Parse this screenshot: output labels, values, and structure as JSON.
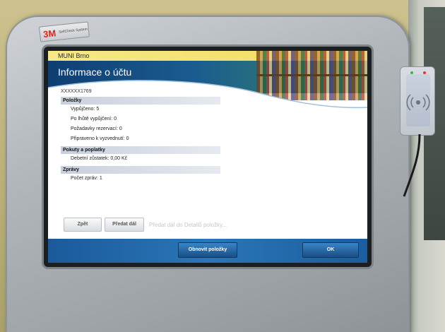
{
  "kiosk": {
    "brand_logo": "3M",
    "brand_sub": "SelfCheck System"
  },
  "screen": {
    "library_name": "MUNI Brno",
    "title": "Informace o účtu",
    "card_id": "XXXXXX1769",
    "sections": {
      "items": {
        "heading": "Položky",
        "rows": [
          "Vypůjčeno: 5",
          "Po lhůtě vypůjčení: 0",
          "Požadavky rezervací: 0",
          "Připraveno k vyzvednutí: 0"
        ]
      },
      "fines": {
        "heading": "Pokuty a poplatky",
        "rows": [
          "Debetní zůstatek: 0,00 Kč"
        ]
      },
      "messages": {
        "heading": "Zprávy",
        "rows": [
          "Počet zpráv: 1"
        ]
      }
    },
    "buttons": {
      "back": "Zpět",
      "forward": "Předat dál",
      "refresh": "Obnovit položky",
      "ok": "OK"
    },
    "hint": "Předat dál do Detailů položky..."
  },
  "colors": {
    "header_blue": "#0e3e72",
    "topbar_yellow": "#f3da5d",
    "footer_blue": "#2a76b8",
    "reader_led_red": "#e03a2a",
    "reader_led_green": "#3ab54a"
  }
}
